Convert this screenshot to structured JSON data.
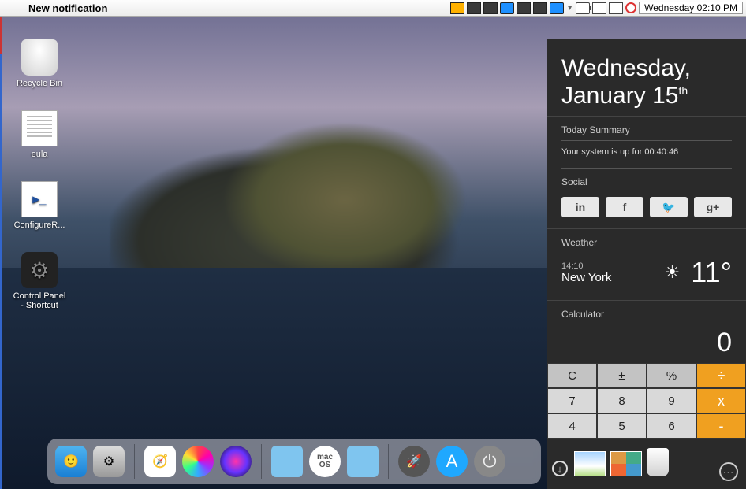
{
  "menubar": {
    "notification": "New notification",
    "datetime": "Wednesday 02:10 PM"
  },
  "desktop_icons": [
    {
      "name": "recycle-bin",
      "label": "Recycle Bin"
    },
    {
      "name": "eula",
      "label": "eula"
    },
    {
      "name": "configure-remoting",
      "label": "ConfigureR..."
    },
    {
      "name": "control-panel",
      "label": "Control Panel\n- Shortcut"
    }
  ],
  "sidebar": {
    "date_line1": "Wednesday,",
    "date_line2": "January 15",
    "date_suffix": "th",
    "summary_header": "Today Summary",
    "uptime_text": "Your system is up for 00:40:46",
    "social_header": "Social",
    "weather_header": "Weather",
    "weather_time": "14:10",
    "weather_city": "New York",
    "weather_temp": "11°",
    "calc_header": "Calculator",
    "calc_display": "0",
    "calc_buttons": {
      "clear": "C",
      "pm": "±",
      "pct": "%",
      "div": "÷",
      "n7": "7",
      "n8": "8",
      "n9": "9",
      "mul": "x",
      "n4": "4",
      "n5": "5",
      "n6": "6",
      "sub": "-"
    }
  },
  "dock_items": [
    {
      "name": "finder"
    },
    {
      "name": "system-preferences"
    },
    {
      "name": "safari"
    },
    {
      "name": "music"
    },
    {
      "name": "siri"
    },
    {
      "name": "documents-folder"
    },
    {
      "name": "macos"
    },
    {
      "name": "downloads-folder"
    },
    {
      "name": "launchpad"
    },
    {
      "name": "app-store"
    },
    {
      "name": "power"
    }
  ]
}
